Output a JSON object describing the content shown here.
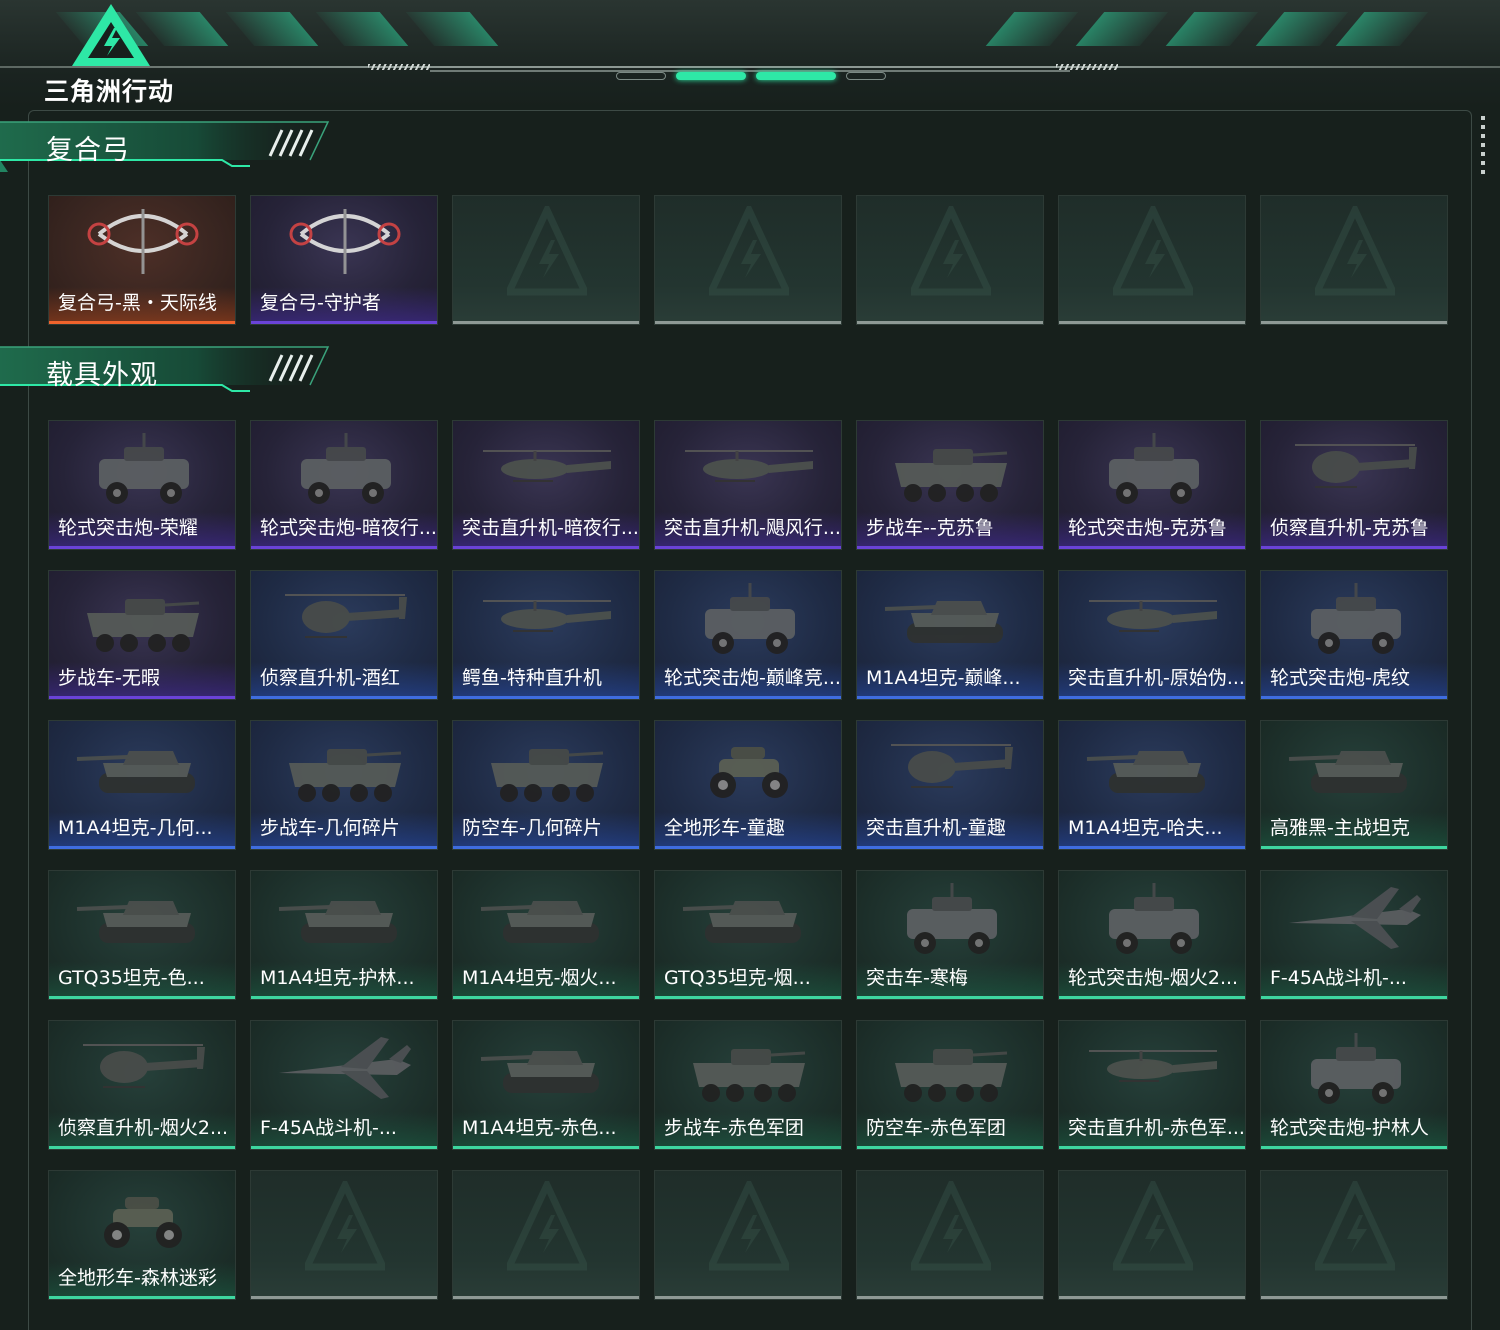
{
  "app": {
    "logo_text": "三角洲行动"
  },
  "colors": {
    "accent": "#2ee8a6",
    "rarity_orange": "#f0632c",
    "rarity_purple": "#6a43d8",
    "rarity_blue": "#3f6de0",
    "rarity_green": "#3ed6a0",
    "empty_slot": "#8e9995"
  },
  "sections": [
    {
      "title": "复合弓",
      "items": [
        {
          "label": "复合弓-黑・天际线",
          "rarity": "orange",
          "icon": "compound-bow-icon"
        },
        {
          "label": "复合弓-守护者",
          "rarity": "purple",
          "icon": "compound-bow-icon"
        },
        {
          "empty": true
        },
        {
          "empty": true
        },
        {
          "empty": true
        },
        {
          "empty": true
        },
        {
          "empty": true
        }
      ]
    },
    {
      "title": "载具外观",
      "items": [
        {
          "label": "轮式突击炮-荣耀",
          "rarity": "purple",
          "icon": "armored-car-icon"
        },
        {
          "label": "轮式突击炮-暗夜行...",
          "rarity": "purple",
          "icon": "armored-car-icon"
        },
        {
          "label": "突击直升机-暗夜行...",
          "rarity": "purple",
          "icon": "attack-helicopter-icon"
        },
        {
          "label": "突击直升机-飓风行...",
          "rarity": "purple",
          "icon": "attack-helicopter-icon"
        },
        {
          "label": "步战车--克苏鲁",
          "rarity": "purple",
          "icon": "ifv-icon"
        },
        {
          "label": "轮式突击炮-克苏鲁",
          "rarity": "purple",
          "icon": "armored-car-icon"
        },
        {
          "label": "侦察直升机-克苏鲁",
          "rarity": "purple",
          "icon": "scout-helicopter-icon"
        },
        {
          "label": "步战车-无暇",
          "rarity": "purple",
          "icon": "ifv-icon"
        },
        {
          "label": "侦察直升机-酒红",
          "rarity": "blue",
          "icon": "scout-helicopter-icon"
        },
        {
          "label": "鳄鱼-特种直升机",
          "rarity": "blue",
          "icon": "attack-helicopter-icon"
        },
        {
          "label": "轮式突击炮-巅峰竞...",
          "rarity": "blue",
          "icon": "armored-car-icon"
        },
        {
          "label": "M1A4坦克-巅峰...",
          "rarity": "blue",
          "icon": "tank-icon"
        },
        {
          "label": "突击直升机-原始伪...",
          "rarity": "blue",
          "icon": "attack-helicopter-icon"
        },
        {
          "label": "轮式突击炮-虎纹",
          "rarity": "blue",
          "icon": "armored-car-icon"
        },
        {
          "label": "M1A4坦克-几何...",
          "rarity": "blue",
          "icon": "tank-icon"
        },
        {
          "label": "步战车-几何碎片",
          "rarity": "blue",
          "icon": "ifv-icon"
        },
        {
          "label": "防空车-几何碎片",
          "rarity": "blue",
          "icon": "ifv-icon"
        },
        {
          "label": "全地形车-童趣",
          "rarity": "blue",
          "icon": "atv-icon"
        },
        {
          "label": "突击直升机-童趣",
          "rarity": "blue",
          "icon": "scout-helicopter-icon"
        },
        {
          "label": "M1A4坦克-哈夫...",
          "rarity": "blue",
          "icon": "tank-icon"
        },
        {
          "label": "高雅黑-主战坦克",
          "rarity": "green",
          "icon": "tank-icon"
        },
        {
          "label": "GTQ35坦克-色...",
          "rarity": "green",
          "icon": "tank-icon"
        },
        {
          "label": "M1A4坦克-护林...",
          "rarity": "green",
          "icon": "tank-icon"
        },
        {
          "label": "M1A4坦克-烟火...",
          "rarity": "green",
          "icon": "tank-icon"
        },
        {
          "label": "GTQ35坦克-烟...",
          "rarity": "green",
          "icon": "tank-icon"
        },
        {
          "label": "突击车-寒梅",
          "rarity": "green",
          "icon": "armored-car-icon"
        },
        {
          "label": "轮式突击炮-烟火2...",
          "rarity": "green",
          "icon": "armored-car-icon"
        },
        {
          "label": "F-45A战斗机-...",
          "rarity": "green",
          "icon": "fighter-jet-icon"
        },
        {
          "label": "侦察直升机-烟火2...",
          "rarity": "green",
          "icon": "scout-helicopter-icon"
        },
        {
          "label": "F-45A战斗机-...",
          "rarity": "green",
          "icon": "fighter-jet-icon"
        },
        {
          "label": "M1A4坦克-赤色...",
          "rarity": "green",
          "icon": "tank-icon"
        },
        {
          "label": "步战车-赤色军团",
          "rarity": "green",
          "icon": "ifv-icon"
        },
        {
          "label": "防空车-赤色军团",
          "rarity": "green",
          "icon": "ifv-icon"
        },
        {
          "label": "突击直升机-赤色军...",
          "rarity": "green",
          "icon": "attack-helicopter-icon"
        },
        {
          "label": "轮式突击炮-护林人",
          "rarity": "green",
          "icon": "armored-car-icon"
        },
        {
          "label": "全地形车-森林迷彩",
          "rarity": "green",
          "icon": "atv-icon"
        },
        {
          "empty": true
        },
        {
          "empty": true
        },
        {
          "empty": true
        },
        {
          "empty": true
        },
        {
          "empty": true
        },
        {
          "empty": true
        }
      ]
    }
  ]
}
